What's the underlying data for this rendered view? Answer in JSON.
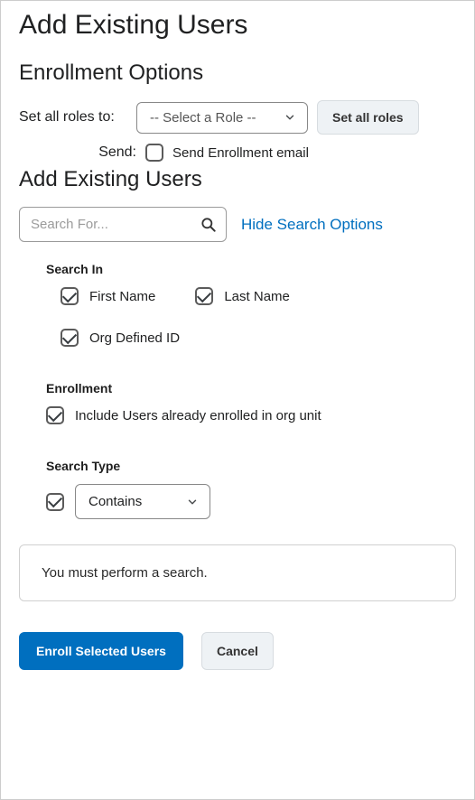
{
  "page_title": "Add Existing Users",
  "enrollment_options": {
    "heading": "Enrollment Options",
    "set_roles_label": "Set all roles to:",
    "role_select_placeholder": "-- Select a Role --",
    "set_all_roles_button": "Set all roles",
    "send_label": "Send:",
    "send_email_checked": false,
    "send_email_label": "Send Enrollment email"
  },
  "add_existing": {
    "heading": "Add Existing Users",
    "search_placeholder": "Search For...",
    "hide_options_link": "Hide Search Options",
    "search_in": {
      "label": "Search In",
      "first_name": {
        "label": "First Name",
        "checked": true
      },
      "last_name": {
        "label": "Last Name",
        "checked": true
      },
      "org_defined_id": {
        "label": "Org Defined ID",
        "checked": true
      }
    },
    "enrollment": {
      "label": "Enrollment",
      "include_enrolled": {
        "label": "Include Users already enrolled in org unit",
        "checked": true
      }
    },
    "search_type": {
      "label": "Search Type",
      "enabled": true,
      "selected": "Contains"
    }
  },
  "notice": "You must perform a search.",
  "buttons": {
    "enroll": "Enroll Selected Users",
    "cancel": "Cancel"
  }
}
